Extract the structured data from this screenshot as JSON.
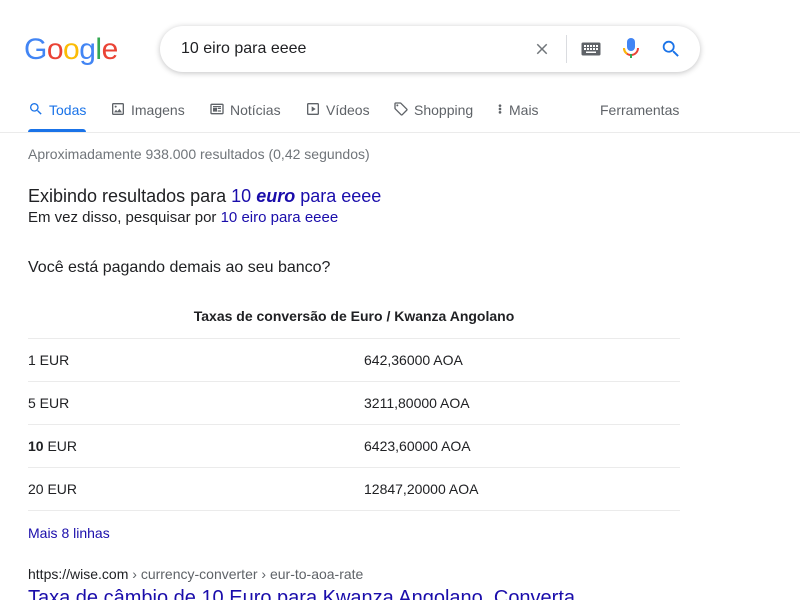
{
  "logo": {
    "letters": [
      "G",
      "o",
      "o",
      "g",
      "l",
      "e"
    ],
    "colors": [
      "#4285f4",
      "#ea4335",
      "#fbbc05",
      "#4285f4",
      "#34a853",
      "#ea4335"
    ]
  },
  "search": {
    "query": "10 eiro para eeee"
  },
  "tabs": [
    {
      "label": "Todas",
      "icon": "search-icon"
    },
    {
      "label": "Imagens",
      "icon": "image-icon"
    },
    {
      "label": "Notícias",
      "icon": "news-icon"
    },
    {
      "label": "Vídeos",
      "icon": "video-icon"
    },
    {
      "label": "Shopping",
      "icon": "tag-icon"
    },
    {
      "label": "Mais",
      "icon": "more-vert-icon"
    },
    {
      "label": "Ferramentas"
    }
  ],
  "stats": "Aproximadamente 938.000 resultados (0,42 segundos)",
  "spell": {
    "prefix": "Exibindo resultados para",
    "corrected_a": "10",
    "corrected_b": "euro",
    "corrected_c": "para eeee",
    "instead_prefix": "Em vez disso, pesquisar por",
    "instead_link": "10 eiro para eeee"
  },
  "banner": "Você está pagando demais ao seu banco?",
  "rates": {
    "title": "Taxas de conversão de Euro / Kwanza Angolano",
    "rows": [
      {
        "amount_bold": "",
        "amount": "1 EUR",
        "value": "642,36000 AOA"
      },
      {
        "amount_bold": "",
        "amount": "5 EUR",
        "value": "3211,80000 AOA"
      },
      {
        "amount_bold": "10",
        "amount": " EUR",
        "value": "6423,60000 AOA"
      },
      {
        "amount_bold": "",
        "amount": "20 EUR",
        "value": "12847,20000 AOA"
      }
    ],
    "more": "Mais 8 linhas"
  },
  "result": {
    "domain": "https://wise.com",
    "path": " › currency-converter › eur-to-aoa-rate",
    "title": "Taxa de câmbio de 10 Euro para Kwanza Angolano. Converta"
  },
  "colors": {
    "accent": "#1a73e8",
    "link": "#1a0dab"
  }
}
